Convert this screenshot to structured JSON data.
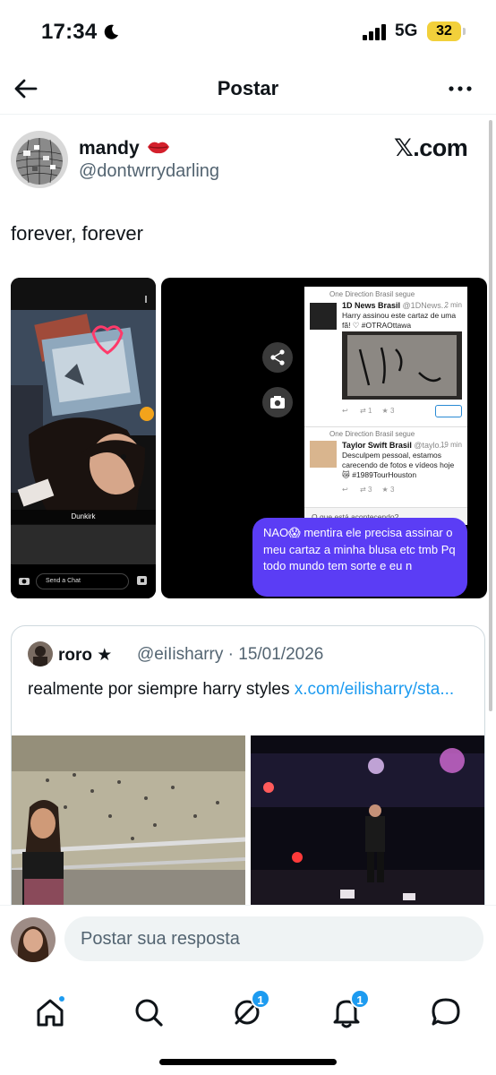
{
  "status_bar": {
    "time": "17:34",
    "network": "5G",
    "battery": "32"
  },
  "header": {
    "title": "Postar"
  },
  "post": {
    "author_name": "mandy",
    "author_handle": "@dontwrrydarling",
    "brand": "𝕏.com",
    "text": "forever, forever",
    "media_left": {
      "caption": "Dunkirk",
      "chat_placeholder": "Send a Chat"
    },
    "media_right": {
      "feed": [
        {
          "follow": "One Direction Brasil segue",
          "account": "1D News Brasil",
          "handle": "@1DNews...",
          "time": "2 min",
          "text": "Harry assinou este cartaz de uma fã! ♡ #OTRAOttawa",
          "reply_count": "1",
          "like_count": "3"
        },
        {
          "follow": "One Direction Brasil segue",
          "account": "Taylor Swift Brasil",
          "handle": "@taylo...",
          "time": "19 min",
          "text": "Desculpem pessoal, estamos carecendo de fotos e vídeos hoje 😿 #1989TourHouston",
          "reply_count": "3",
          "like_count": "3"
        }
      ],
      "compose_placeholder": "O que está acontecendo?",
      "message": "NAO😱 mentira ele precisa assinar o meu cartaz a minha blusa etc tmb Pq todo mundo tem sorte e eu n"
    }
  },
  "quote": {
    "author_name": "roro ★",
    "author_handle": "@eiIisharry",
    "date": "15/01/2026",
    "text": "realmente por siempre harry styles ",
    "link": "x.com/eilisharry/sta..."
  },
  "reply": {
    "placeholder": "Postar sua resposta"
  },
  "tabbar": {
    "grok_badge": "1",
    "notifications_badge": "1"
  },
  "colors": {
    "accent": "#1d9bf0",
    "bubble": "#5b3df5",
    "battery": "#f2d03b"
  }
}
